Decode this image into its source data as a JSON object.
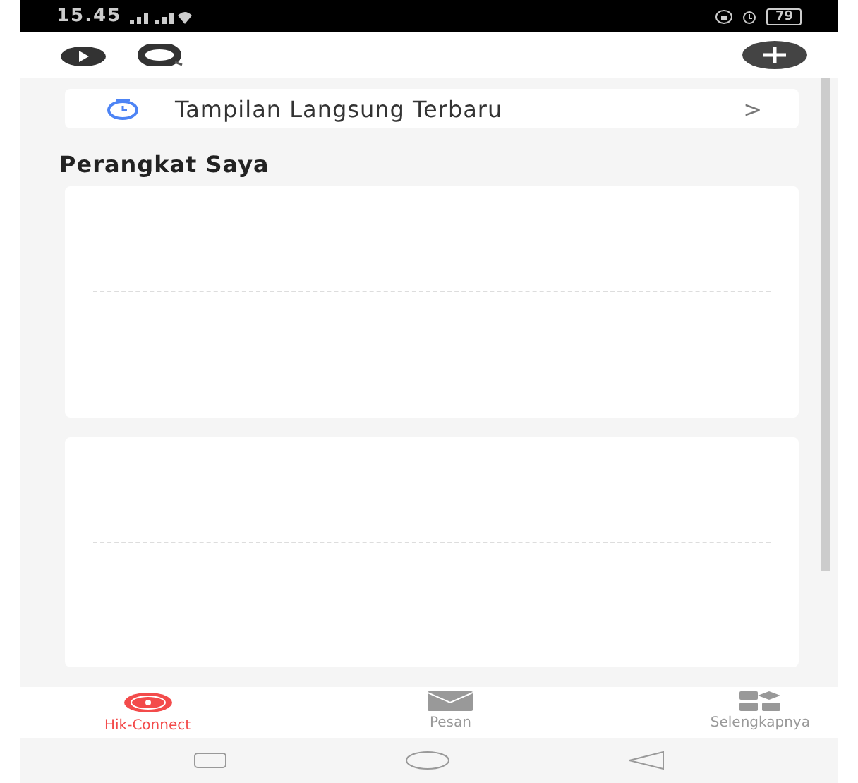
{
  "status_bar": {
    "time": "15.45",
    "battery": "79"
  },
  "recent_live_view": {
    "label": "Tampilan Langsung Terbaru",
    "chevron": ">"
  },
  "section_title": "Perangkat Saya",
  "device_cards": [
    {
      "kind": "empty"
    },
    {
      "kind": "empty"
    }
  ],
  "bottom_nav": [
    {
      "label": "Hik-Connect",
      "kind": "home",
      "selected": true
    },
    {
      "label": "Pesan",
      "kind": "message",
      "selected": false
    },
    {
      "label": "Selengkapnya",
      "kind": "more",
      "selected": false
    }
  ]
}
